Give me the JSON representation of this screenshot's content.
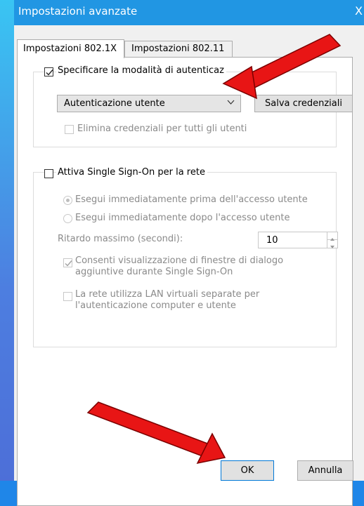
{
  "window": {
    "title": "Impostazioni avanzate",
    "close_glyph": "X"
  },
  "tabs": [
    {
      "label": "Impostazioni 802.1X",
      "selected": true
    },
    {
      "label": "Impostazioni 802.11",
      "selected": false
    }
  ],
  "auth_group": {
    "specify_mode_label": "Specificare la modalità di autenticaz",
    "specify_mode_checked": true,
    "mode_select_value": "Autenticazione utente",
    "save_credentials_label": "Salva credenziali",
    "delete_credentials_label": "Elimina credenziali per tutti gli utenti",
    "delete_credentials_checked": false
  },
  "sso_group": {
    "enable_sso_label": "Attiva Single Sign-On per la rete",
    "enable_sso_checked": false,
    "before_logon_label": "Esegui immediatamente prima dell'accesso utente",
    "before_logon_selected": true,
    "after_logon_label": "Esegui immediatamente dopo l'accesso utente",
    "max_delay_label": "Ritardo massimo (secondi):",
    "max_delay_value": "10",
    "allow_dialogs_label": "Consenti visualizzazione di finestre di dialogo aggiuntive durante Single Sign-On",
    "allow_dialogs_checked": true,
    "separate_vlan_label": "La rete utilizza LAN virtuali separate per l'autenticazione computer e utente",
    "separate_vlan_checked": false
  },
  "footer": {
    "ok_label": "OK",
    "cancel_label": "Annulla"
  },
  "colors": {
    "titlebar": "#2196e3",
    "annotation_arrow": "#e81515"
  }
}
